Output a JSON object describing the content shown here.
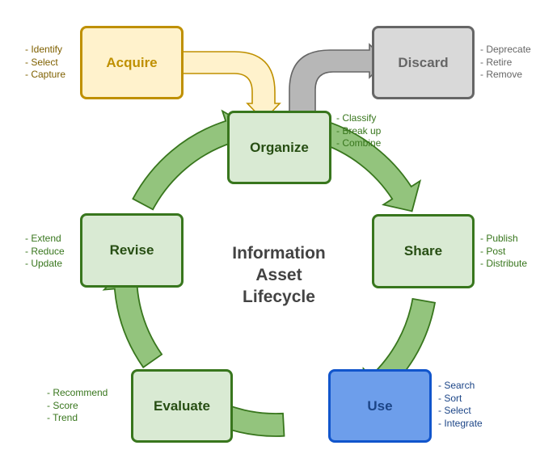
{
  "title": "Information Asset Lifecycle",
  "title_lines": [
    "Information",
    "Asset",
    "Lifecycle"
  ],
  "colors": {
    "green_fill": "#d9ead3",
    "green_stroke": "#38761d",
    "green_arrow": "#93c47d",
    "yellow_fill": "#fff2cc",
    "yellow_stroke": "#bf9000",
    "gray_fill": "#d9d9d9",
    "gray_arrow": "#b7b7b7",
    "gray_stroke": "#666666",
    "blue_fill": "#6d9eeb",
    "blue_stroke": "#1155cc"
  },
  "stages": {
    "acquire": {
      "label": "Acquire",
      "notes": [
        "- Identify",
        "- Select",
        "- Capture"
      ]
    },
    "discard": {
      "label": "Discard",
      "notes": [
        "- Deprecate",
        "- Retire",
        "- Remove"
      ]
    },
    "organize": {
      "label": "Organize",
      "notes": [
        "- Classify",
        "- Break up",
        "- Combine"
      ]
    },
    "share": {
      "label": "Share",
      "notes": [
        "- Publish",
        "- Post",
        "- Distribute"
      ]
    },
    "use": {
      "label": "Use",
      "notes": [
        "- Search",
        "- Sort",
        "- Select",
        "- Integrate"
      ]
    },
    "evaluate": {
      "label": "Evaluate",
      "notes": [
        "- Recommend",
        "- Score",
        "- Trend"
      ]
    },
    "revise": {
      "label": "Revise",
      "notes": [
        "- Extend",
        "- Reduce",
        "- Update"
      ]
    }
  },
  "flows": [
    {
      "from": "acquire",
      "to": "organize"
    },
    {
      "from": "organize",
      "to": "discard"
    },
    {
      "from": "organize",
      "to": "share"
    },
    {
      "from": "share",
      "to": "use"
    },
    {
      "from": "use",
      "to": "evaluate"
    },
    {
      "from": "evaluate",
      "to": "revise"
    },
    {
      "from": "revise",
      "to": "organize"
    }
  ]
}
